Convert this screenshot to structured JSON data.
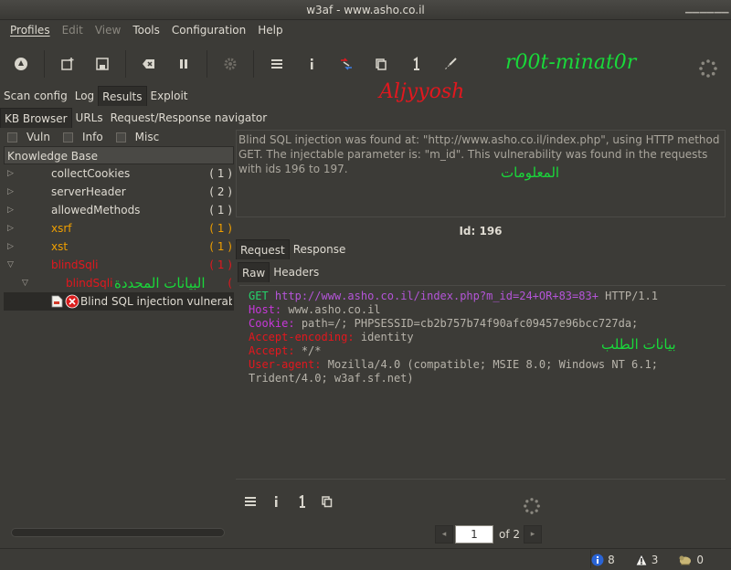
{
  "window": {
    "title": "w3af - www.asho.co.il"
  },
  "menu": [
    {
      "label": "Profiles",
      "disabled": false
    },
    {
      "label": "Edit",
      "disabled": true
    },
    {
      "label": "View",
      "disabled": true
    },
    {
      "label": "Tools",
      "disabled": false
    },
    {
      "label": "Configuration",
      "disabled": false
    },
    {
      "label": "Help",
      "disabled": false
    }
  ],
  "brand": {
    "text": "r00t-minat0r",
    "sub": "Aljyyosh"
  },
  "main_tabs": [
    "Scan config",
    "Log",
    "Results",
    "Exploit"
  ],
  "results_tabs": [
    "KB Browser",
    "URLs",
    "Request/Response navigator"
  ],
  "filters": [
    "Vuln",
    "Info",
    "Misc"
  ],
  "kb": {
    "header": "Knowledge Base",
    "items": [
      {
        "label": "collectCookies",
        "count": "( 1 )",
        "color": "#dfdbd2"
      },
      {
        "label": "serverHeader",
        "count": "( 2 )",
        "color": "#dfdbd2"
      },
      {
        "label": "allowedMethods",
        "count": "( 1 )",
        "color": "#dfdbd2"
      },
      {
        "label": "xsrf",
        "count": "( 1 )",
        "color": "#f0a000"
      },
      {
        "label": "xst",
        "count": "( 1 )",
        "color": "#f0a000"
      },
      {
        "label": "blindSqli",
        "count": "( 1 )",
        "color": "#e3171e"
      },
      {
        "label": "blindSqli",
        "count": "(",
        "color": "#e3171e"
      }
    ],
    "selected": "Blind SQL injection vulnerabilit"
  },
  "annotations": {
    "selected_data": "البيانات المحددة",
    "info": "المعلومات",
    "request_data": "بيانات الطلب"
  },
  "detail": {
    "description": "Blind SQL injection was found at: \"http://www.asho.co.il/index.php\", using HTTP method GET. The injectable parameter is: \"m_id\". This vulnerability was found in the requests with ids 196 to 197.",
    "id_label": "Id: 196"
  },
  "reqres_tabs": [
    "Request",
    "Response"
  ],
  "view_tabs": [
    "Raw",
    "Headers"
  ],
  "request": {
    "method": "GET",
    "url": "http://www.asho.co.il/index.php?m_id=24+OR+83=83+",
    "protocol": "HTTP/1.1",
    "headers": [
      {
        "name": "Host",
        "value": "www.asho.co.il",
        "color": "#c638d9"
      },
      {
        "name": "Cookie",
        "value": "path=/; PHPSESSID=cb2b757b74f90afc09457e96bcc727da;",
        "color": "#c638d9"
      },
      {
        "name": "Accept-encoding",
        "value": "identity",
        "color": "#e3171e"
      },
      {
        "name": "Accept",
        "value": "*/*",
        "color": "#e3171e"
      },
      {
        "name": "User-agent",
        "value": "Mozilla/4.0 (compatible; MSIE 8.0; Windows NT 6.1;",
        "color": "#e3171e"
      }
    ],
    "continuation": "Trident/4.0; w3af.sf.net)"
  },
  "pager": {
    "current": "1",
    "total": "of 2"
  },
  "status": {
    "info": "8",
    "warnings": "3",
    "errors": "0"
  }
}
